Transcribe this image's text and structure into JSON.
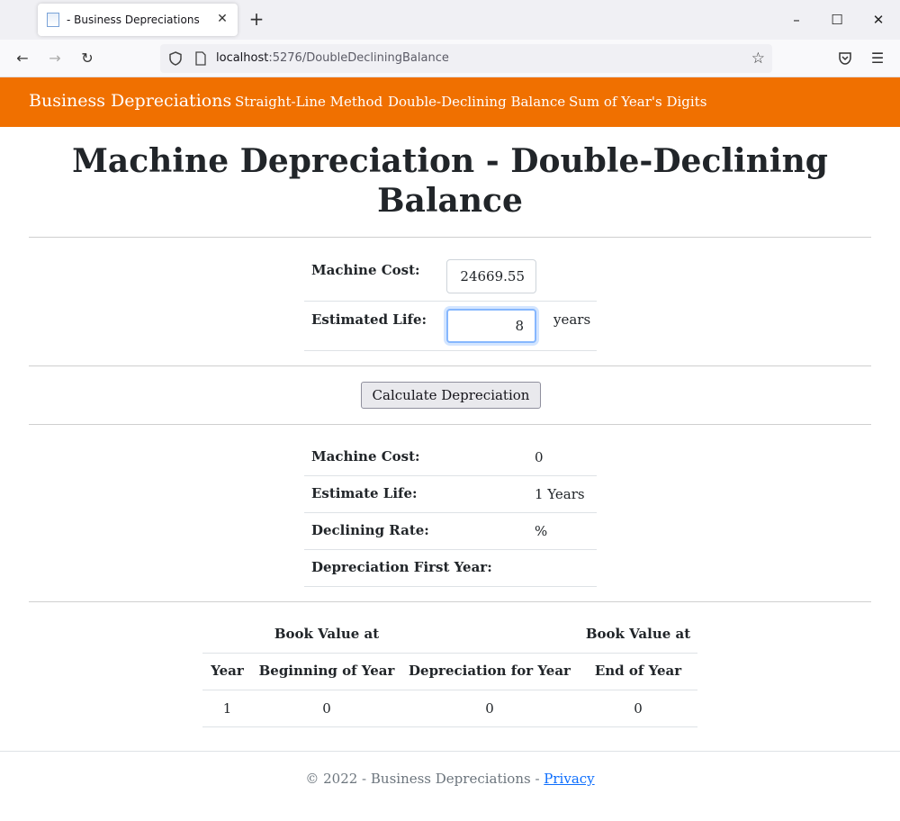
{
  "browser": {
    "tab_title": "- Business Depreciations",
    "new_tab": "+",
    "url_host": "localhost",
    "url_rest": ":5276/DoubleDecliningBalance",
    "minimize": "–",
    "maximize": "☐",
    "close": "✕"
  },
  "header": {
    "brand": "Business Depreciations",
    "nav": [
      "Straight-Line Method",
      "Double-Declining Balance",
      "Sum of Year's Digits"
    ],
    "color": "#f07000"
  },
  "page": {
    "title": "Machine Depreciation - Double-Declining Balance"
  },
  "form": {
    "machine_cost_label": "Machine Cost:",
    "machine_cost_value": "24669.55",
    "estimated_life_label": "Estimated Life:",
    "estimated_life_value": "8",
    "years_suffix": "years",
    "calculate_button": "Calculate Depreciation"
  },
  "summary": {
    "rows": [
      {
        "label": "Machine Cost:",
        "value": "0"
      },
      {
        "label": "Estimate Life:",
        "value": "1 Years"
      },
      {
        "label": "Declining Rate:",
        "value": "%"
      },
      {
        "label": "Depreciation First Year:",
        "value": ""
      }
    ]
  },
  "schedule": {
    "header_top": [
      "",
      "Book Value at",
      "",
      "Book Value at"
    ],
    "header_bottom": [
      "Year",
      "Beginning of Year",
      "Depreciation for Year",
      "End of Year"
    ],
    "rows": [
      [
        "1",
        "0",
        "0",
        "0"
      ]
    ]
  },
  "footer": {
    "text": "© 2022 - Business Depreciations - ",
    "privacy_link": "Privacy"
  }
}
